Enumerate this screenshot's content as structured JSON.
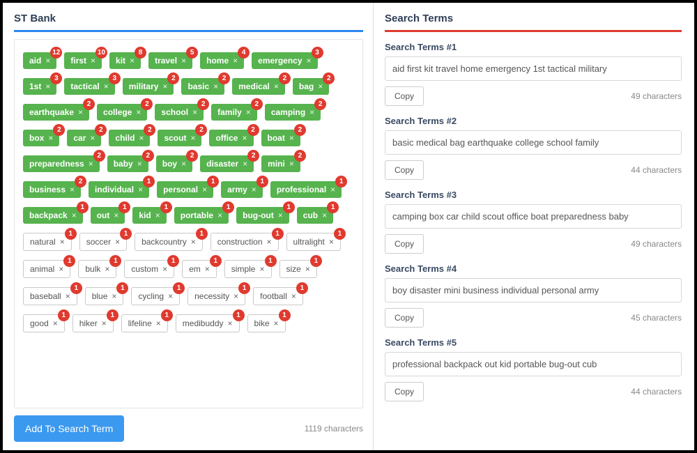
{
  "left": {
    "title": "ST Bank",
    "add_btn": "Add To Search Term",
    "char_count": "1119 characters",
    "tags": [
      {
        "label": "aid",
        "count": 12,
        "style": "green"
      },
      {
        "label": "first",
        "count": 10,
        "style": "green"
      },
      {
        "label": "kit",
        "count": 8,
        "style": "green"
      },
      {
        "label": "travel",
        "count": 5,
        "style": "green"
      },
      {
        "label": "home",
        "count": 4,
        "style": "green"
      },
      {
        "label": "emergency",
        "count": 3,
        "style": "green"
      },
      {
        "label": "1st",
        "count": 3,
        "style": "green"
      },
      {
        "label": "tactical",
        "count": 3,
        "style": "green"
      },
      {
        "label": "military",
        "count": 2,
        "style": "green"
      },
      {
        "label": "basic",
        "count": 2,
        "style": "green"
      },
      {
        "label": "medical",
        "count": 2,
        "style": "green"
      },
      {
        "label": "bag",
        "count": 2,
        "style": "green"
      },
      {
        "label": "earthquake",
        "count": 2,
        "style": "green"
      },
      {
        "label": "college",
        "count": 2,
        "style": "green"
      },
      {
        "label": "school",
        "count": 2,
        "style": "green"
      },
      {
        "label": "family",
        "count": 2,
        "style": "green"
      },
      {
        "label": "camping",
        "count": 2,
        "style": "green"
      },
      {
        "label": "box",
        "count": 2,
        "style": "green"
      },
      {
        "label": "car",
        "count": 2,
        "style": "green"
      },
      {
        "label": "child",
        "count": 2,
        "style": "green"
      },
      {
        "label": "scout",
        "count": 2,
        "style": "green"
      },
      {
        "label": "office",
        "count": 2,
        "style": "green"
      },
      {
        "label": "boat",
        "count": 2,
        "style": "green"
      },
      {
        "label": "preparedness",
        "count": 2,
        "style": "green"
      },
      {
        "label": "baby",
        "count": 2,
        "style": "green"
      },
      {
        "label": "boy",
        "count": 2,
        "style": "green"
      },
      {
        "label": "disaster",
        "count": 2,
        "style": "green"
      },
      {
        "label": "mini",
        "count": 2,
        "style": "green"
      },
      {
        "label": "business",
        "count": 2,
        "style": "green"
      },
      {
        "label": "individual",
        "count": 1,
        "style": "green"
      },
      {
        "label": "personal",
        "count": 1,
        "style": "green"
      },
      {
        "label": "army",
        "count": 1,
        "style": "green"
      },
      {
        "label": "professional",
        "count": 1,
        "style": "green"
      },
      {
        "label": "backpack",
        "count": 1,
        "style": "green"
      },
      {
        "label": "out",
        "count": 1,
        "style": "green"
      },
      {
        "label": "kid",
        "count": 1,
        "style": "green"
      },
      {
        "label": "portable",
        "count": 1,
        "style": "green"
      },
      {
        "label": "bug-out",
        "count": 1,
        "style": "green"
      },
      {
        "label": "cub",
        "count": 1,
        "style": "green"
      },
      {
        "label": "natural",
        "count": 1,
        "style": "white"
      },
      {
        "label": "soccer",
        "count": 1,
        "style": "white"
      },
      {
        "label": "backcountry",
        "count": 1,
        "style": "white"
      },
      {
        "label": "construction",
        "count": 1,
        "style": "white"
      },
      {
        "label": "ultralight",
        "count": 1,
        "style": "white"
      },
      {
        "label": "animal",
        "count": 1,
        "style": "white"
      },
      {
        "label": "bulk",
        "count": 1,
        "style": "white"
      },
      {
        "label": "custom",
        "count": 1,
        "style": "white"
      },
      {
        "label": "em",
        "count": 1,
        "style": "white"
      },
      {
        "label": "simple",
        "count": 1,
        "style": "white"
      },
      {
        "label": "size",
        "count": 1,
        "style": "white"
      },
      {
        "label": "baseball",
        "count": 1,
        "style": "white"
      },
      {
        "label": "blue",
        "count": 1,
        "style": "white"
      },
      {
        "label": "cycling",
        "count": 1,
        "style": "white"
      },
      {
        "label": "necessity",
        "count": 1,
        "style": "white"
      },
      {
        "label": "football",
        "count": 1,
        "style": "white"
      },
      {
        "label": "good",
        "count": 1,
        "style": "white"
      },
      {
        "label": "hiker",
        "count": 1,
        "style": "white"
      },
      {
        "label": "lifeline",
        "count": 1,
        "style": "white"
      },
      {
        "label": "medibuddy",
        "count": 1,
        "style": "white"
      },
      {
        "label": "bike",
        "count": 1,
        "style": "white"
      }
    ]
  },
  "right": {
    "title": "Search Terms",
    "copy_label": "Copy",
    "terms": [
      {
        "label": "Search Terms #1",
        "value": "aid first kit travel home emergency 1st tactical military",
        "cc": "49 characters"
      },
      {
        "label": "Search Terms #2",
        "value": "basic medical bag earthquake college school family",
        "cc": "44 characters"
      },
      {
        "label": "Search Terms #3",
        "value": "camping box car child scout office boat preparedness baby",
        "cc": "49 characters"
      },
      {
        "label": "Search Terms #4",
        "value": "boy disaster mini business individual personal army",
        "cc": "45 characters"
      },
      {
        "label": "Search Terms #5",
        "value": "professional backpack out kid portable bug-out cub",
        "cc": "44 characters"
      }
    ]
  }
}
